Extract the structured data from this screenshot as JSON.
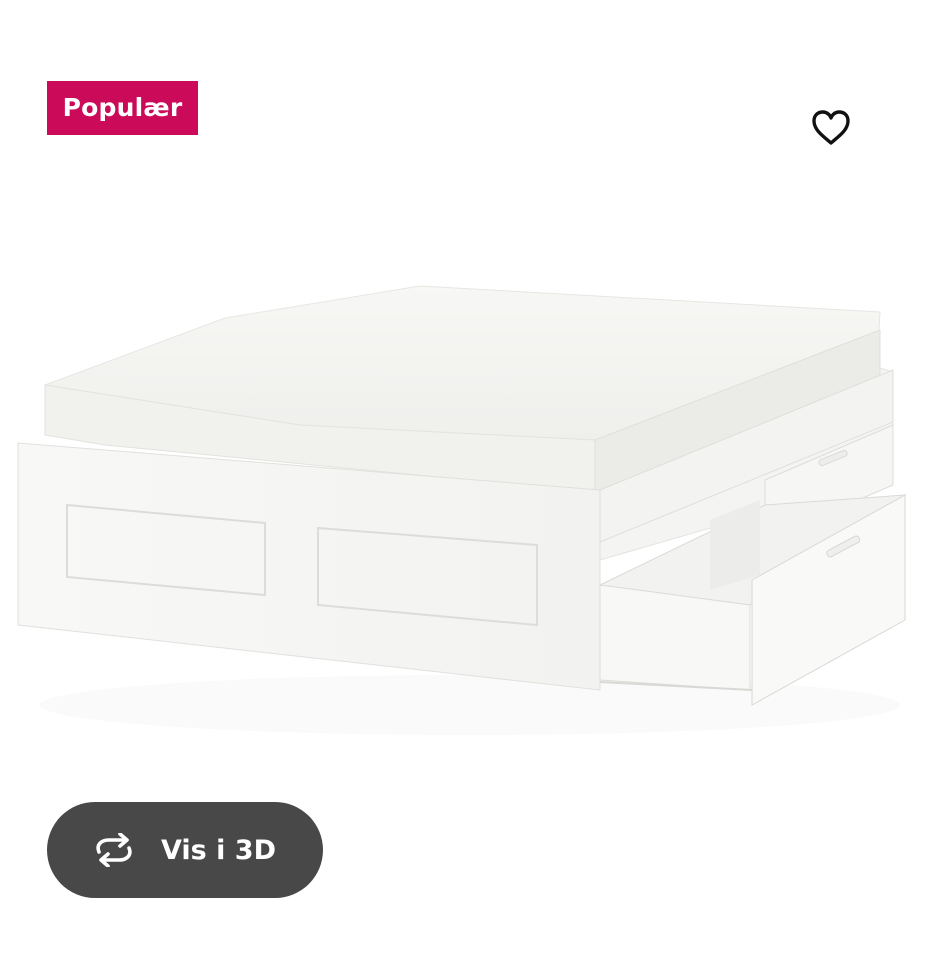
{
  "badge": {
    "label": "Populær",
    "color": "#cc0a5a"
  },
  "favorite": {
    "icon": "heart-outline-icon"
  },
  "product_image": {
    "subject": "white-bed-frame-with-drawers"
  },
  "view_3d": {
    "label": "Vis i 3D",
    "icon": "rotate-arrows-icon",
    "background": "#484848"
  }
}
